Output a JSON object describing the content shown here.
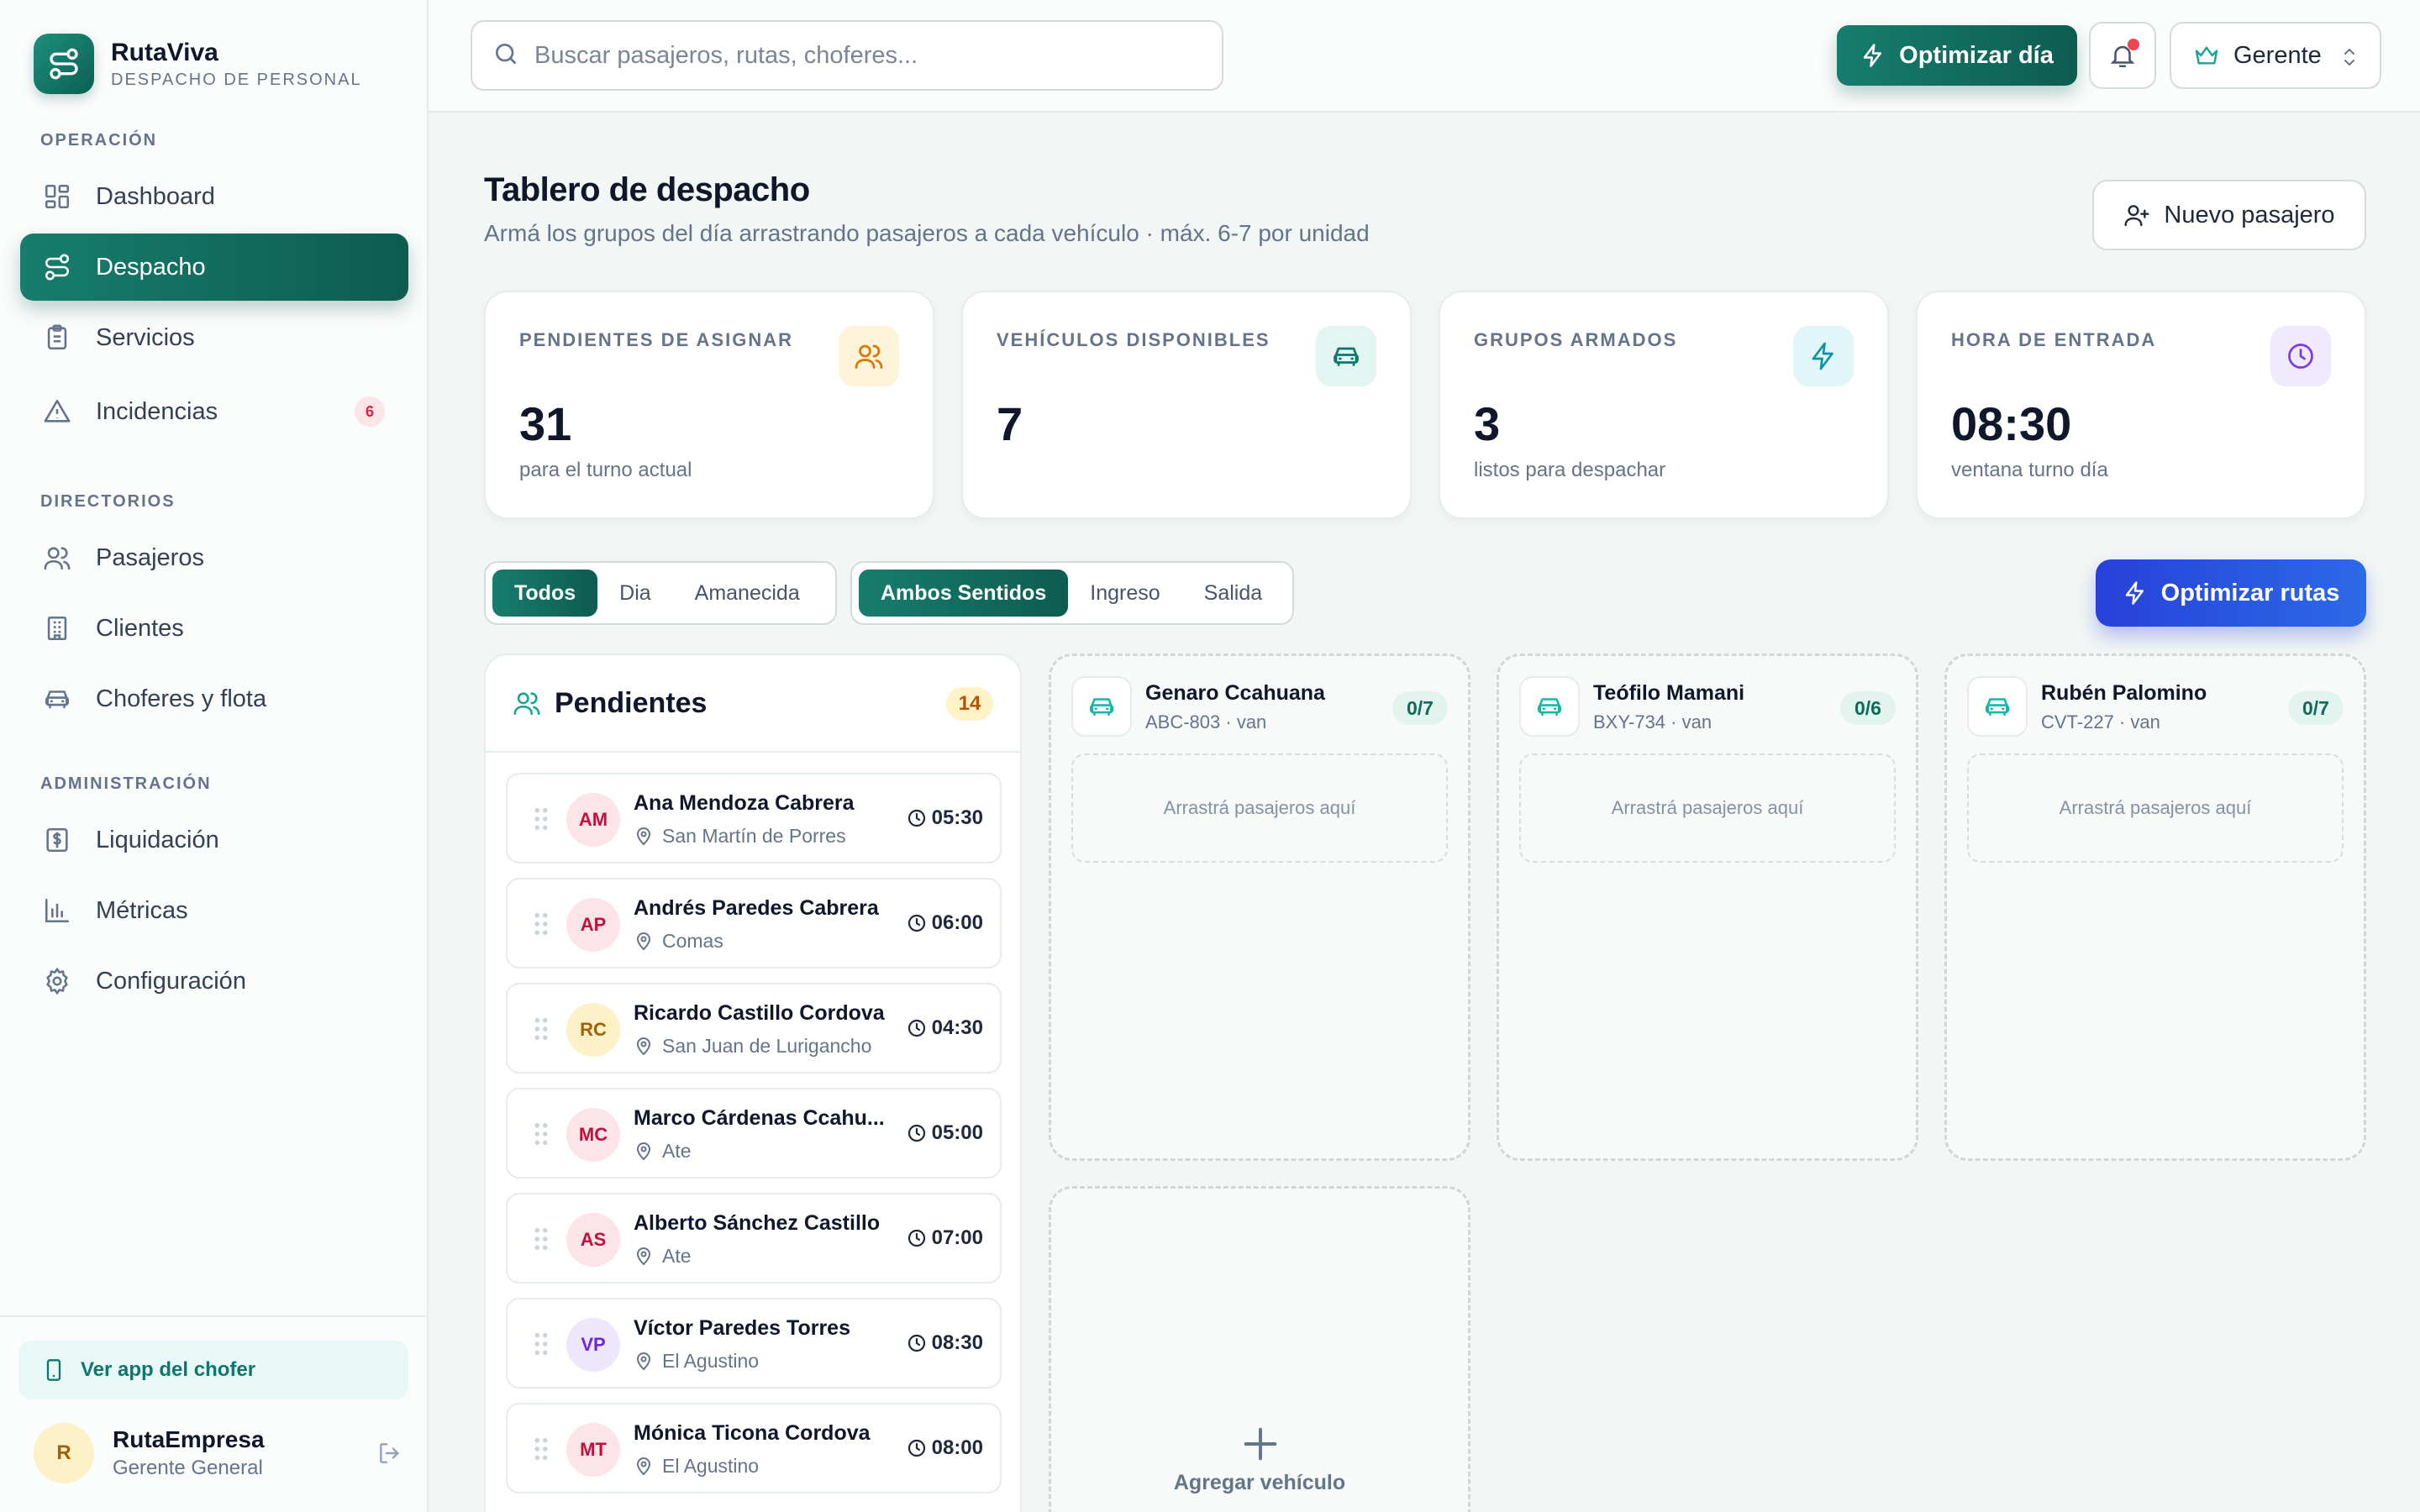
{
  "brand": {
    "name": "RutaViva",
    "subtitle": "DESPACHO DE PERSONAL"
  },
  "sidebar": {
    "sections": {
      "operacion": "OPERACIÓN",
      "directorios": "DIRECTORIOS",
      "administracion": "ADMINISTRACIÓN"
    },
    "items": [
      {
        "label": "Dashboard",
        "icon": "dashboard-icon"
      },
      {
        "label": "Despacho",
        "icon": "route-icon",
        "active": true
      },
      {
        "label": "Servicios",
        "icon": "clipboard-icon"
      },
      {
        "label": "Incidencias",
        "icon": "warning-icon",
        "badge": "6"
      },
      {
        "label": "Pasajeros",
        "icon": "users-icon"
      },
      {
        "label": "Clientes",
        "icon": "building-icon"
      },
      {
        "label": "Choferes y flota",
        "icon": "car-icon"
      },
      {
        "label": "Liquidación",
        "icon": "dollar-icon"
      },
      {
        "label": "Métricas",
        "icon": "bar-chart-icon"
      },
      {
        "label": "Configuración",
        "icon": "gear-icon"
      }
    ],
    "driver_app": "Ver app del chofer",
    "user": {
      "initial": "R",
      "name": "RutaEmpresa",
      "role": "Gerente General"
    }
  },
  "header": {
    "search_placeholder": "Buscar pasajeros, rutas, choferes...",
    "optimize_day": "Optimizar día",
    "role": "Gerente"
  },
  "main": {
    "title": "Tablero de despacho",
    "subtitle": "Armá los grupos del día arrastrando pasajeros a cada vehículo · máx. 6-7 por unidad",
    "new_passenger": "Nuevo pasajero",
    "stats": [
      {
        "label": "PENDIENTES DE ASIGNAR",
        "value": "31",
        "note": "para el turno actual",
        "icon": "users-icon"
      },
      {
        "label": "VEHÍCULOS DISPONIBLES",
        "value": "7",
        "note": "",
        "icon": "car-icon"
      },
      {
        "label": "GRUPOS ARMADOS",
        "value": "3",
        "note": "listos para despachar",
        "icon": "bolt-icon"
      },
      {
        "label": "HORA DE ENTRADA",
        "value": "08:30",
        "note": "ventana turno día",
        "icon": "clock-icon"
      }
    ],
    "shift_filter": [
      "Todos",
      "Dia",
      "Amanecida"
    ],
    "direction_filter": [
      "Ambos Sentidos",
      "Ingreso",
      "Salida"
    ],
    "optimize_routes": "Optimizar rutas",
    "pending": {
      "title": "Pendientes",
      "count": "14",
      "rows": [
        {
          "initials": "AM",
          "name": "Ana Mendoza Cabrera",
          "location": "San Martín de Porres",
          "time": "05:30"
        },
        {
          "initials": "AP",
          "name": "Andrés Paredes Cabrera",
          "location": "Comas",
          "time": "06:00"
        },
        {
          "initials": "RC",
          "name": "Ricardo Castillo Cordova",
          "location": "San Juan de Lurigancho",
          "time": "04:30"
        },
        {
          "initials": "MC",
          "name": "Marco Cárdenas Ccahu...",
          "location": "Ate",
          "time": "05:00"
        },
        {
          "initials": "AS",
          "name": "Alberto Sánchez Castillo",
          "location": "Ate",
          "time": "07:00"
        },
        {
          "initials": "VP",
          "name": "Víctor Paredes Torres",
          "location": "El Agustino",
          "time": "08:30"
        },
        {
          "initials": "MT",
          "name": "Mónica Ticona Cordova",
          "location": "El Agustino",
          "time": "08:00"
        }
      ]
    },
    "vehicles": [
      {
        "driver": "Genaro Ccahuana",
        "plate": "ABC-803 · van",
        "capacity": "0/7",
        "drop": "Arrastrá pasajeros aquí"
      },
      {
        "driver": "Teófilo Mamani",
        "plate": "BXY-734 · van",
        "capacity": "0/6",
        "drop": "Arrastrá pasajeros aquí"
      },
      {
        "driver": "Rubén Palomino",
        "plate": "CVT-227 · van",
        "capacity": "0/7",
        "drop": "Arrastrá pasajeros aquí"
      }
    ],
    "add_vehicle": "Agregar vehículo"
  },
  "colors": {
    "accent": "#177d6d",
    "accent_dark": "#0d5c50",
    "blue": "#2741d8",
    "background": "#f2f6f5",
    "danger": "#e11d48"
  }
}
